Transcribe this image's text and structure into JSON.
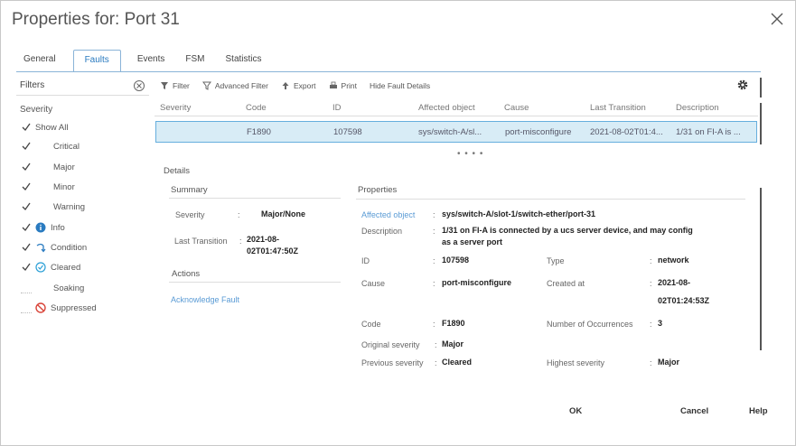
{
  "dialog": {
    "title": "Properties for: Port 31"
  },
  "tabs": [
    {
      "label": "General"
    },
    {
      "label": "Faults"
    },
    {
      "label": "Events"
    },
    {
      "label": "FSM"
    },
    {
      "label": "Statistics"
    }
  ],
  "filters": {
    "header": "Filters",
    "severity_label": "Severity",
    "items": [
      {
        "label": "Show All",
        "checked": true
      },
      {
        "label": "Critical",
        "checked": true
      },
      {
        "label": "Major",
        "checked": true
      },
      {
        "label": "Minor",
        "checked": true
      },
      {
        "label": "Warning",
        "checked": true
      },
      {
        "label": "Info",
        "checked": true,
        "icon": "info-icon"
      },
      {
        "label": "Condition",
        "checked": true,
        "icon": "condition-icon"
      },
      {
        "label": "Cleared",
        "checked": true,
        "icon": "cleared-icon"
      },
      {
        "label": "Soaking",
        "checked": false
      },
      {
        "label": "Suppressed",
        "checked": false,
        "icon": "suppressed-icon"
      }
    ]
  },
  "toolbar": {
    "filter": "Filter",
    "advanced_filter": "Advanced Filter",
    "export": "Export",
    "print": "Print",
    "hide_fault_details": "Hide Fault Details"
  },
  "grid": {
    "columns": [
      "Severity",
      "Code",
      "ID",
      "Affected object",
      "Cause",
      "Last Transition",
      "Description"
    ],
    "rows": [
      {
        "severity": "",
        "code": "F1890",
        "id": "107598",
        "affected_object": "sys/switch-A/sl...",
        "cause": "port-misconfigure",
        "last_transition": "2021-08-02T01:4...",
        "description": "1/31 on FI-A is ..."
      }
    ],
    "more": "• • • •"
  },
  "details": {
    "header": "Details",
    "summary": {
      "header": "Summary",
      "severity_label": "Severity",
      "severity_value": "Major/None",
      "last_transition_label": "Last Transition",
      "last_transition_value_1": "2021-08-",
      "last_transition_value_2": "02T01:47:50Z"
    },
    "actions": {
      "header": "Actions",
      "acknowledge": "Acknowledge Fault"
    },
    "properties": {
      "header": "Properties",
      "affected_object_label": "Affected object",
      "affected_object_value": "sys/switch-A/slot-1/switch-ether/port-31",
      "description_label": "Description",
      "description_value_1": "1/31 on FI-A is connected by a ucs server device, and may config",
      "description_value_2": "as a server port",
      "id_label": "ID",
      "id_value": "107598",
      "type_label": "Type",
      "type_value": "network",
      "cause_label": "Cause",
      "cause_value": "port-misconfigure",
      "created_at_label": "Created at",
      "created_at_value_1": "2021-08-",
      "created_at_value_2": "02T01:24:53Z",
      "code_label": "Code",
      "code_value": "F1890",
      "occurrences_label": "Number of Occurrences",
      "occurrences_value": "3",
      "original_severity_label": "Original severity",
      "original_severity_value": "Major",
      "previous_severity_label": "Previous severity",
      "previous_severity_value": "Cleared",
      "highest_severity_label": "Highest severity",
      "highest_severity_value": "Major"
    }
  },
  "footer": {
    "ok": "OK",
    "cancel": "Cancel",
    "help": "Help"
  },
  "colors": {
    "accent": "#2a7bc0",
    "row_selected": "#d8ecf6",
    "info": "#2a7bc0",
    "suppressed": "#d9453a"
  }
}
